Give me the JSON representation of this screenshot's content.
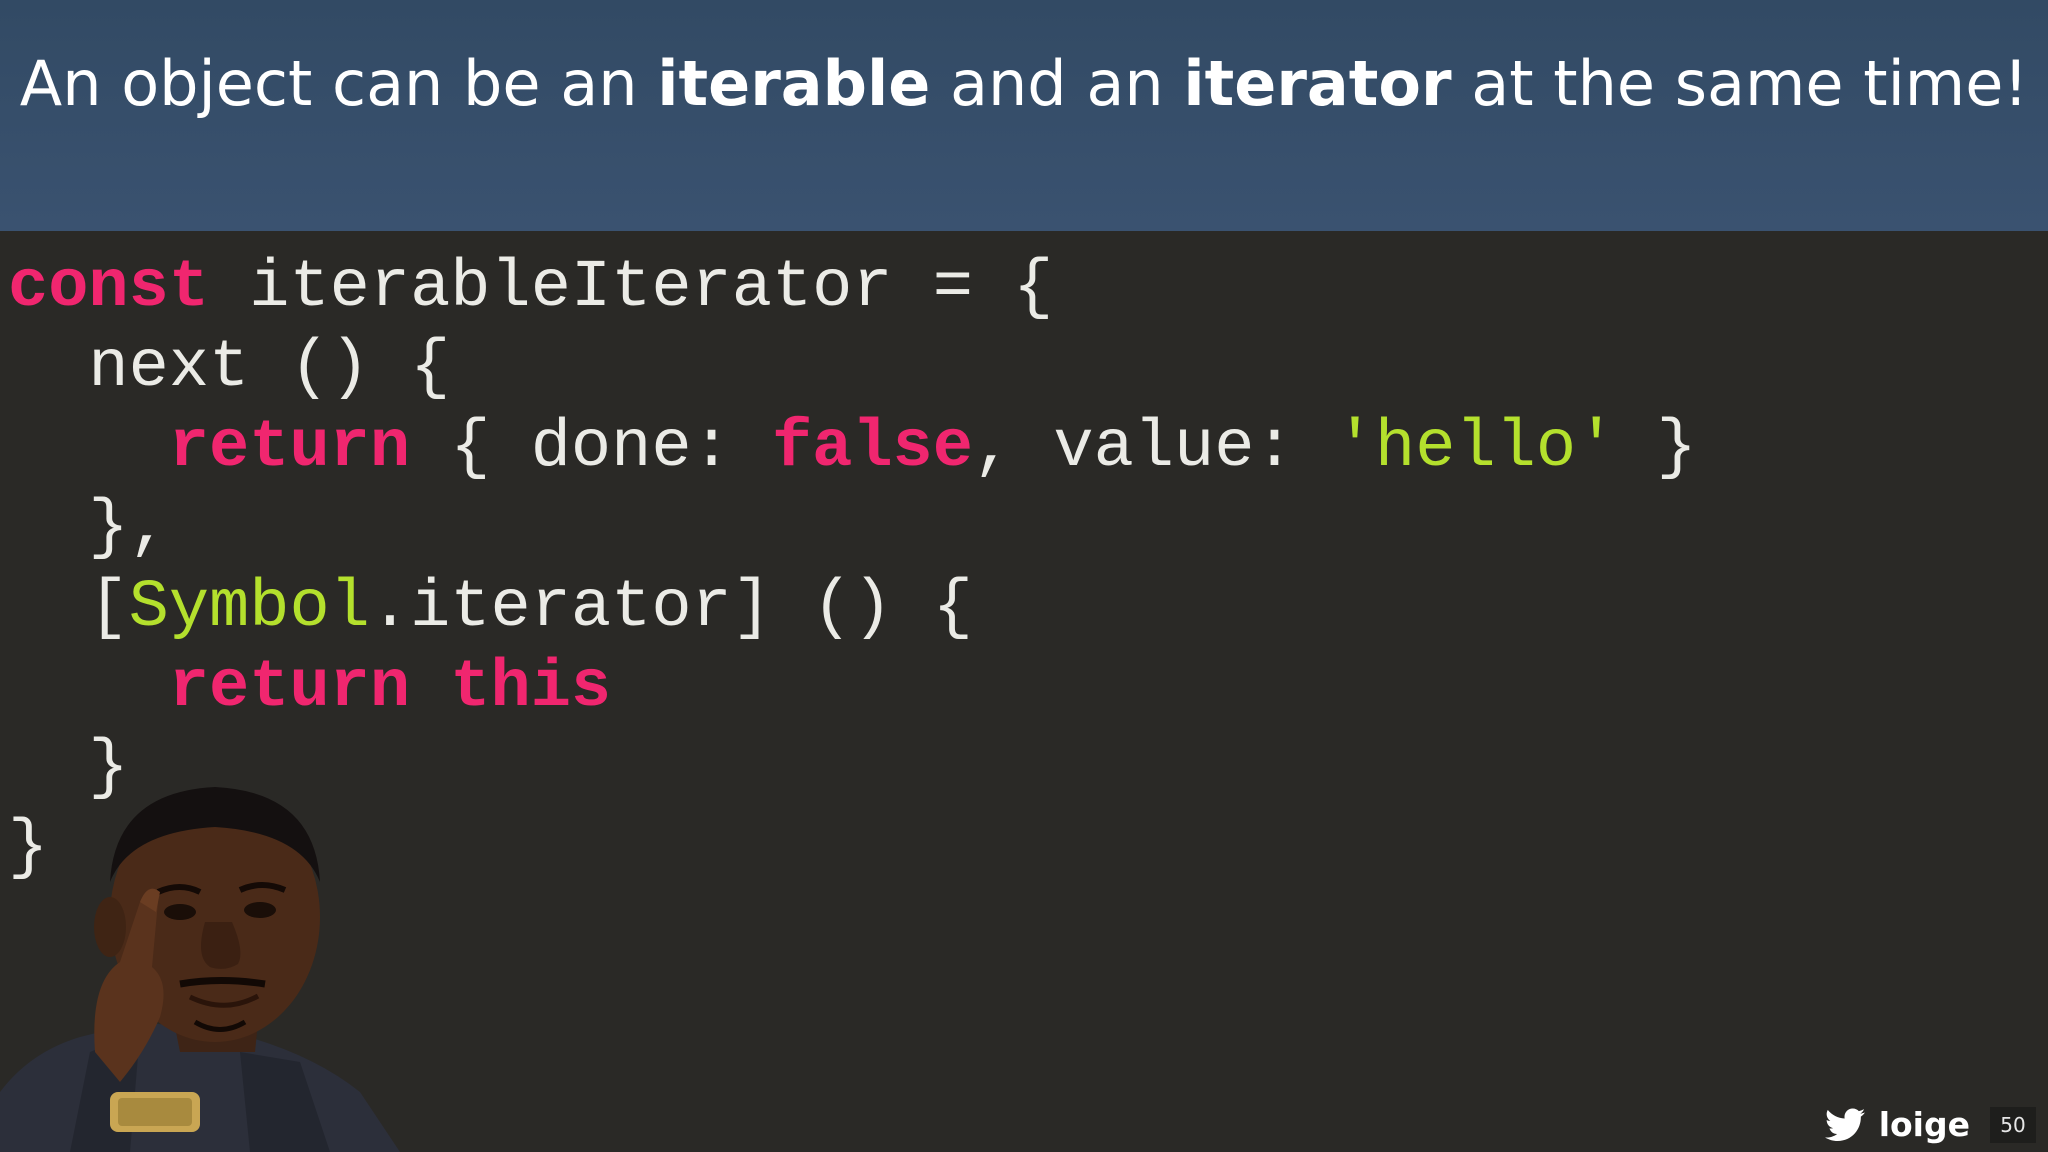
{
  "slide": {
    "title": {
      "part1": "An object can be an ",
      "bold1": "iterable",
      "part2": " and an ",
      "bold2": "iterator",
      "part3": " at the same time!"
    },
    "code": {
      "l1_kw": "const",
      "l1_rest": " iterableIterator = {",
      "l2": "  next () {",
      "l3_indent": "    ",
      "l3_kw_return": "return",
      "l3_mid": " { done: ",
      "l3_kw_false": "false",
      "l3_mid2": ", value: ",
      "l3_str": "'hello'",
      "l3_end": " }",
      "l4": "  },",
      "l5_open": "  [",
      "l5_symbol": "Symbol",
      "l5_rest": ".iterator] () {",
      "l6_indent": "    ",
      "l6_kw_return": "return",
      "l6_space": " ",
      "l6_kw_this": "this",
      "l7": "  }",
      "l8": "}"
    },
    "footer": {
      "icon": "twitter-bird-icon",
      "handle": "loige",
      "page_number": "50"
    },
    "image": "roll-safe-thinking-meme"
  },
  "colors": {
    "header_bg": "#354d68",
    "code_bg": "#2a2926",
    "code_text": "#ebebe6",
    "keyword": "#f0266f",
    "string": "#b4e02d",
    "twitter_icon": "#ffffff"
  }
}
